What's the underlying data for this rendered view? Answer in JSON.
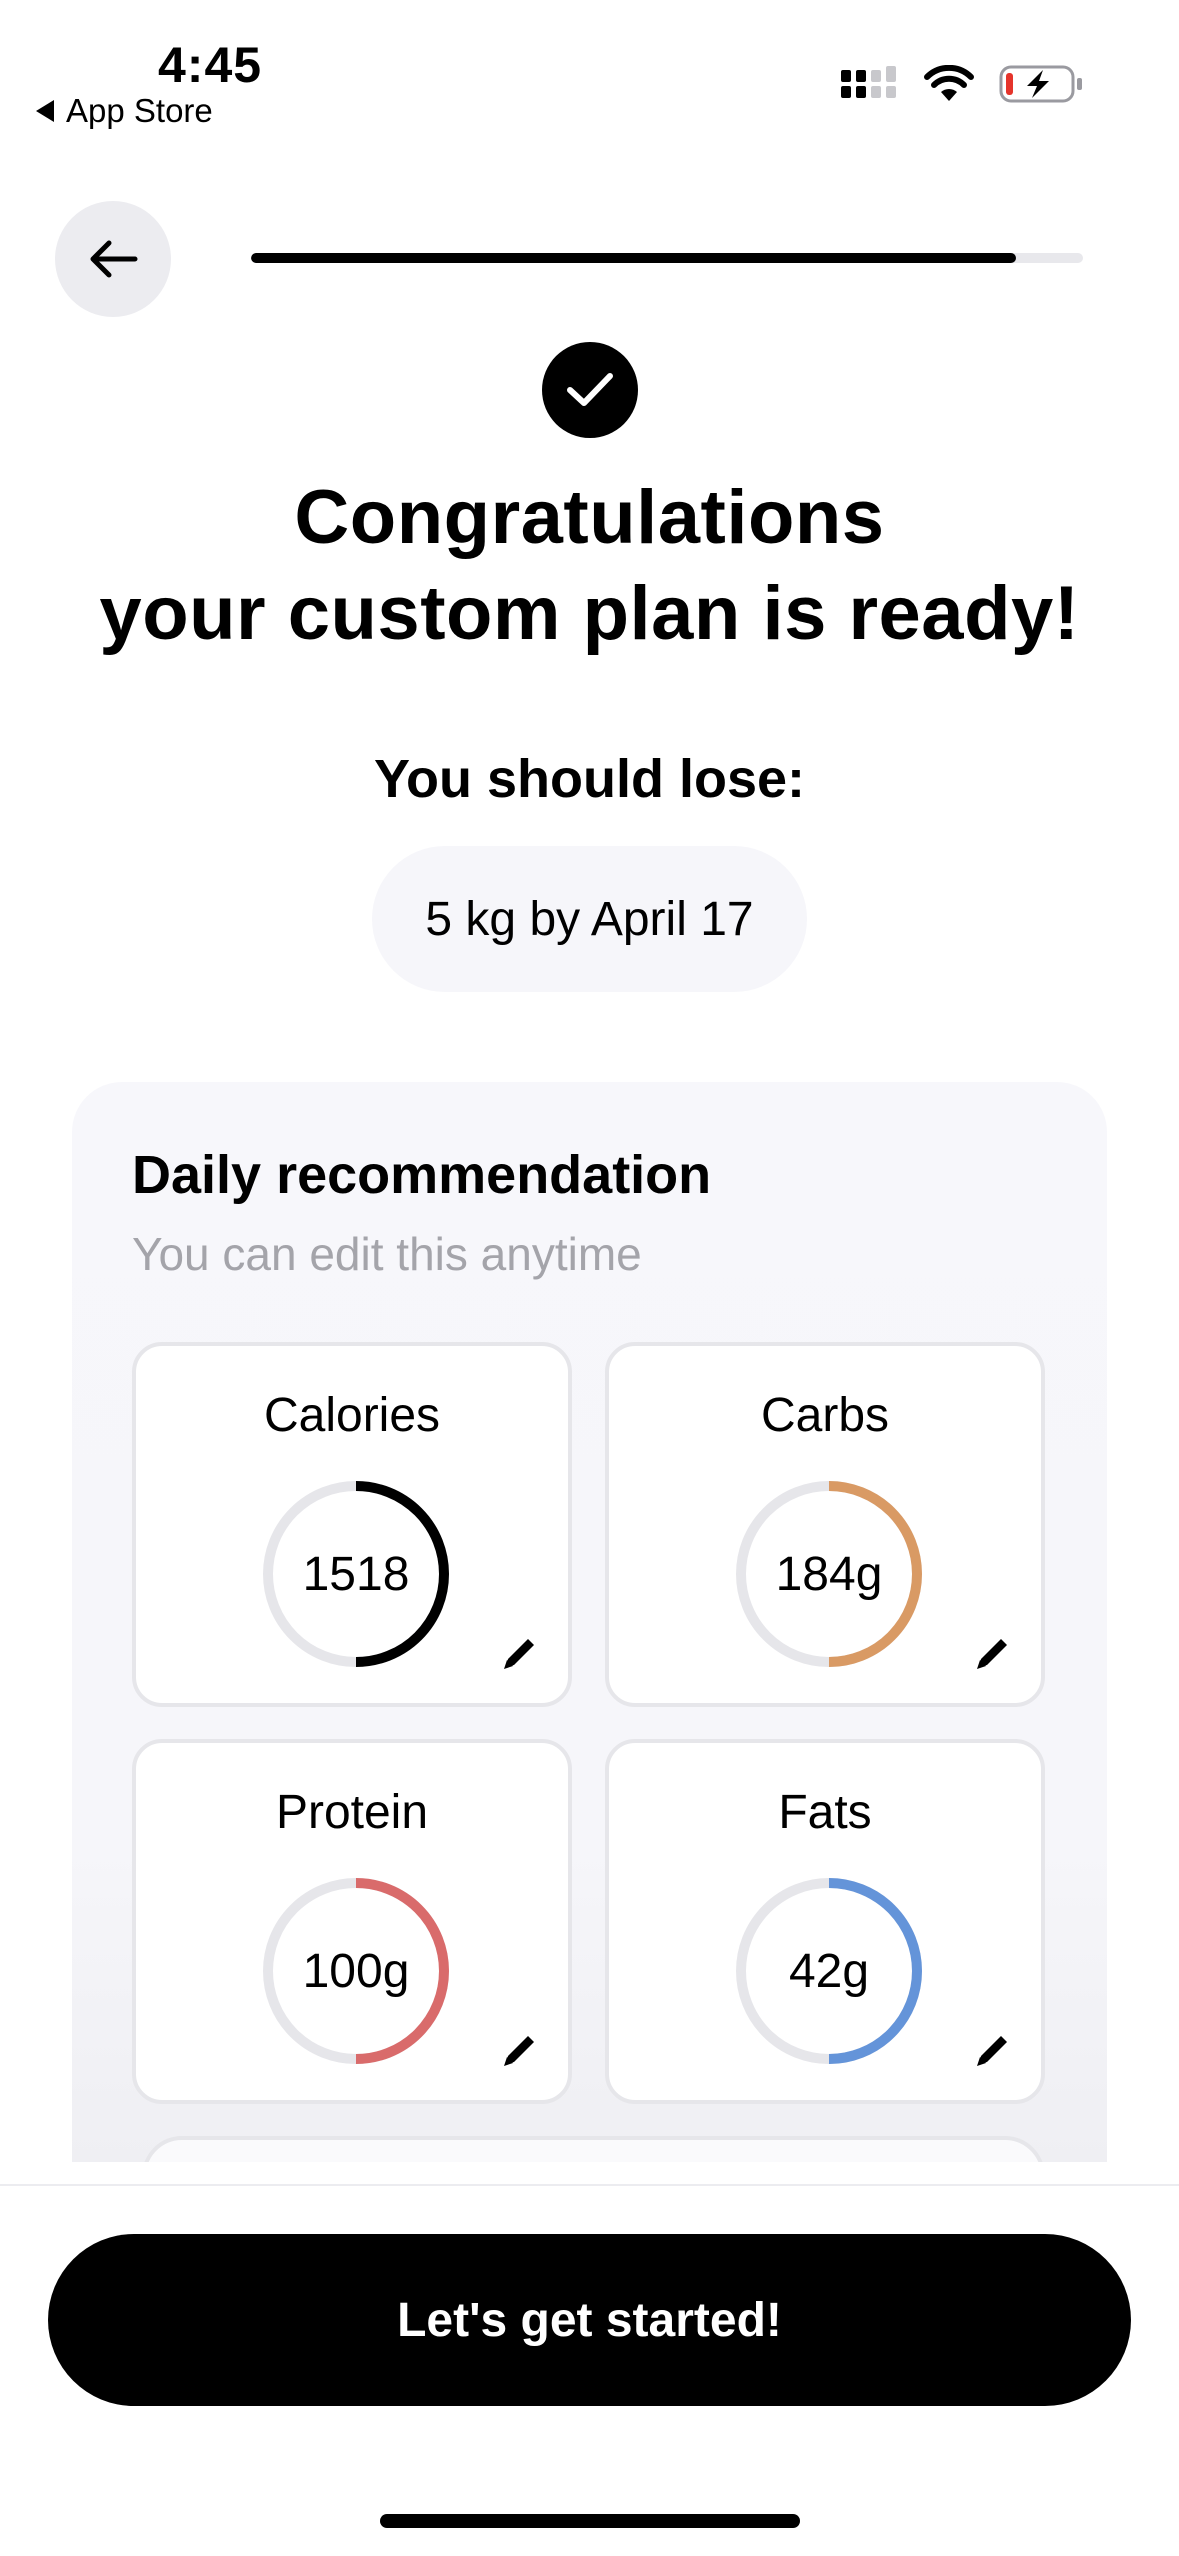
{
  "status_bar": {
    "time": "4:45",
    "back_app": "App Store"
  },
  "nav": {
    "progress": 0.92
  },
  "header": {
    "title_line1": "Congratulations",
    "title_line2": "your custom plan is ready!"
  },
  "goal": {
    "label": "You should lose:",
    "value": "5 kg by April 17"
  },
  "daily": {
    "title": "Daily recommendation",
    "subtitle": "You can edit this anytime",
    "macros": [
      {
        "label": "Calories",
        "value": "1518",
        "progress": 0.5,
        "color": "#000000"
      },
      {
        "label": "Carbs",
        "value": "184g",
        "progress": 0.5,
        "color": "#d99a64"
      },
      {
        "label": "Protein",
        "value": "100g",
        "progress": 0.5,
        "color": "#d96b6b"
      },
      {
        "label": "Fats",
        "value": "42g",
        "progress": 0.5,
        "color": "#6494d9"
      }
    ]
  },
  "cta": {
    "label": "Let's get started!"
  },
  "icons": {
    "back": "arrow-left-icon",
    "check": "checkmark-icon",
    "edit": "pencil-icon",
    "signal": "cellular-signal-icon",
    "wifi": "wifi-icon",
    "battery": "battery-charging-icon"
  }
}
